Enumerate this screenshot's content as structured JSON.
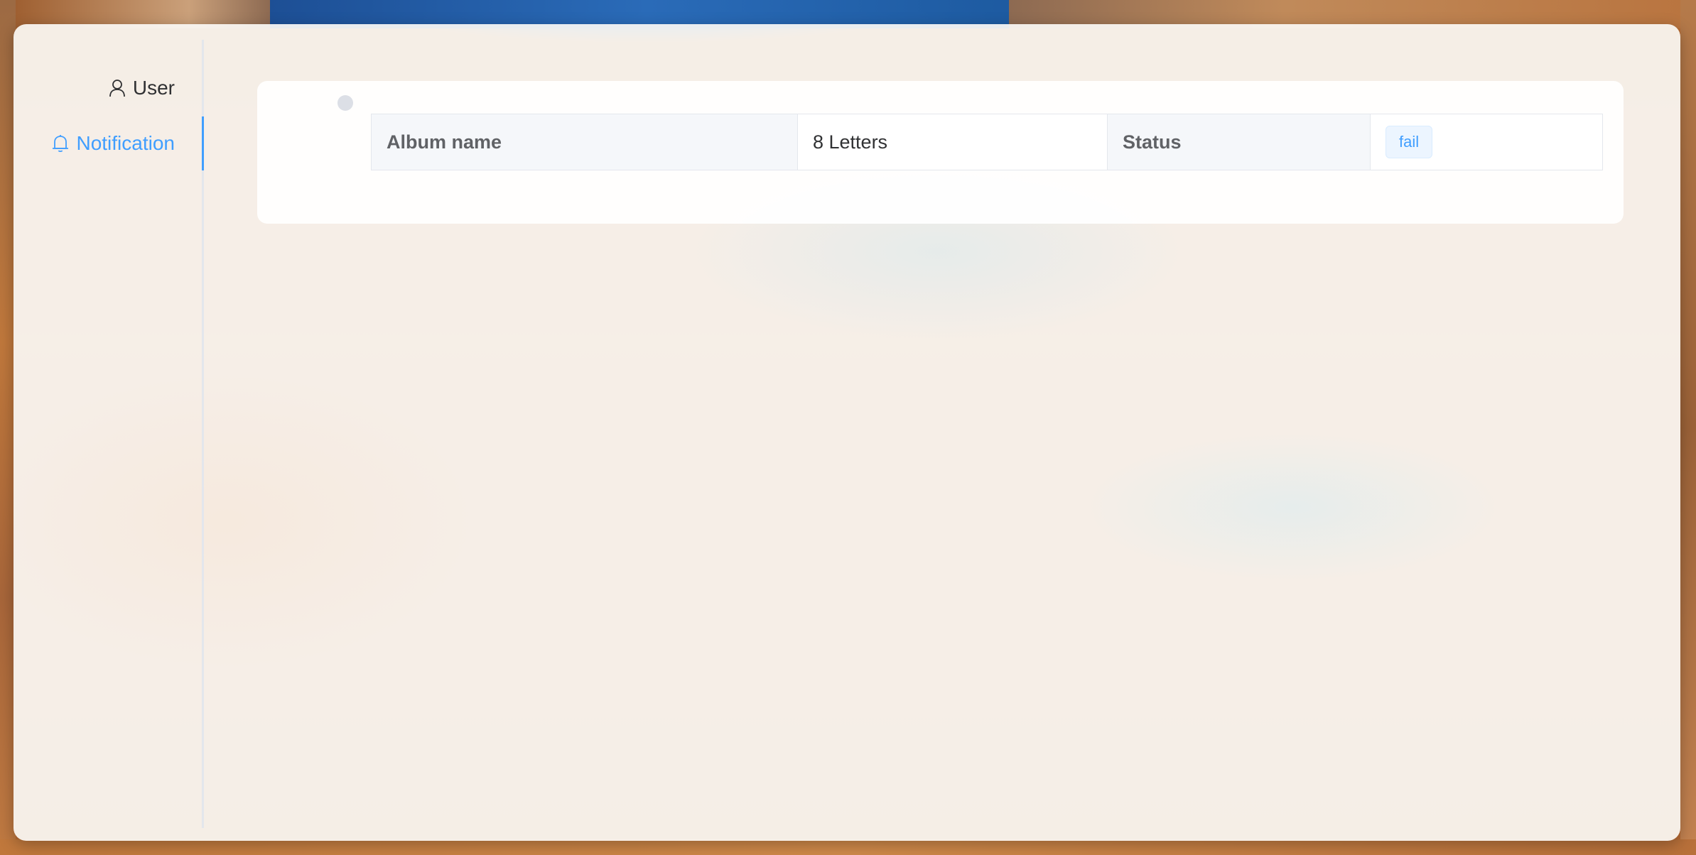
{
  "sidebar": {
    "items": [
      {
        "label": "User",
        "icon": "user-icon",
        "active": false
      },
      {
        "label": "Notification",
        "icon": "bell-icon",
        "active": true
      }
    ]
  },
  "details": {
    "album_label": "Album name",
    "album_value": "8 Letters",
    "status_label": "Status",
    "status_value": "fail"
  },
  "colors": {
    "accent": "#409eff",
    "tag_bg": "#ecf5ff",
    "label_bg": "#f5f7fa"
  }
}
